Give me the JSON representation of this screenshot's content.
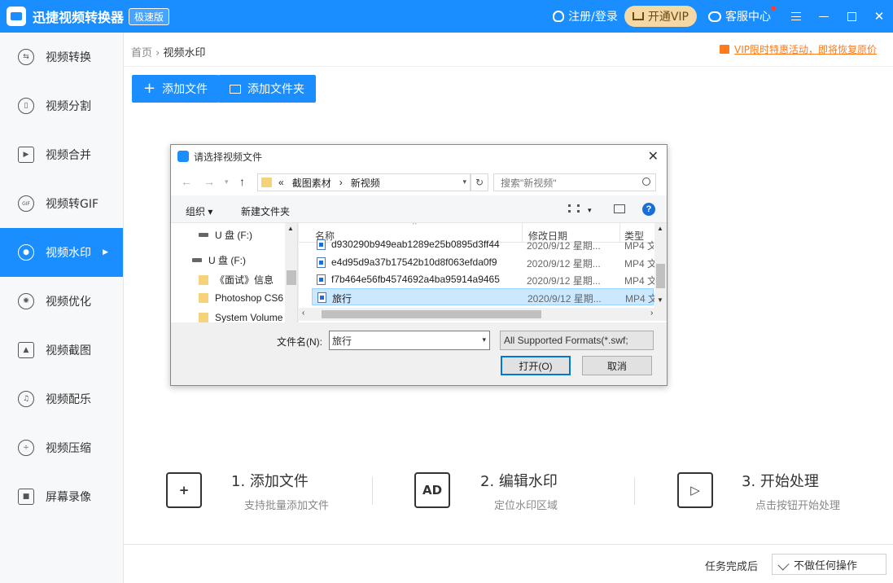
{
  "titlebar": {
    "app_title": "迅捷视频转换器",
    "badge": "极速版",
    "login": "注册/登录",
    "vip": "开通VIP",
    "service": "客服中心"
  },
  "sidebar": {
    "items": [
      {
        "label": "视频转换",
        "icon": "convert-icon"
      },
      {
        "label": "视频分割",
        "icon": "split-icon"
      },
      {
        "label": "视频合并",
        "icon": "merge-icon"
      },
      {
        "label": "视频转GIF",
        "icon": "gif-icon"
      },
      {
        "label": "视频水印",
        "icon": "watermark-icon",
        "active": true
      },
      {
        "label": "视频优化",
        "icon": "optimize-icon"
      },
      {
        "label": "视频截图",
        "icon": "screenshot-icon"
      },
      {
        "label": "视频配乐",
        "icon": "music-icon"
      },
      {
        "label": "视频压缩",
        "icon": "compress-icon"
      },
      {
        "label": "屏幕录像",
        "icon": "record-icon"
      }
    ]
  },
  "breadcrumb": {
    "home": "首页",
    "sep": "›",
    "current": "视频水印"
  },
  "promo": "VIP限时特惠活动，即将恢复原价",
  "toolbar": {
    "add_file": "添加文件",
    "add_folder": "添加文件夹"
  },
  "dialog": {
    "title": "请选择视频文件",
    "path": [
      "«",
      "截图素材",
      "›",
      "新视频"
    ],
    "search_placeholder": "搜索\"新视频\"",
    "organize": "组织 ▾",
    "new_folder": "新建文件夹",
    "help": "?",
    "tree": [
      "U 盘 (F:)",
      "U 盘 (F:)",
      "《面试》信息",
      "Photoshop CS6",
      "System Volume"
    ],
    "columns": {
      "name": "名称",
      "date": "修改日期",
      "type": "类型"
    },
    "files": [
      {
        "name": "d930290b949eab1289e25b0895d3ff44",
        "date": "2020/9/12 星期...",
        "type": "MP4 文"
      },
      {
        "name": "e4d95d9a37b17542b10d8f063efda0f9",
        "date": "2020/9/12 星期...",
        "type": "MP4 文"
      },
      {
        "name": "f7b464e56fb4574692a4ba95914a9465",
        "date": "2020/9/12 星期...",
        "type": "MP4 文"
      },
      {
        "name": "旅行",
        "date": "2020/9/12 星期...",
        "type": "MP4 文",
        "selected": true
      }
    ],
    "filename_label": "文件名(N):",
    "filename_value": "旅行",
    "format": "All Supported Formats(*.swf;",
    "open": "打开(O)",
    "cancel": "取消"
  },
  "steps": [
    {
      "title": "1. 添加文件",
      "sub": "支持批量添加文件",
      "icon": "add-file-icon"
    },
    {
      "title": "2. 编辑水印",
      "sub": "定位水印区域",
      "icon": "ad-icon",
      "glyph": "AD"
    },
    {
      "title": "3. 开始处理",
      "sub": "点击按钮开始处理",
      "icon": "clapper-icon"
    }
  ],
  "footer": {
    "label": "任务完成后",
    "option": "不做任何操作"
  }
}
